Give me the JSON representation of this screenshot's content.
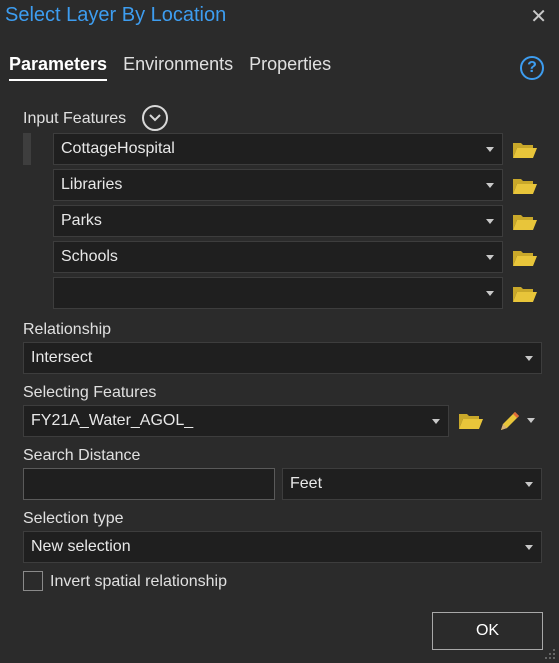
{
  "window": {
    "title": "Select Layer By Location",
    "close_glyph": "✕"
  },
  "tabs": [
    {
      "label": "Parameters",
      "active": true
    },
    {
      "label": "Environments",
      "active": false
    },
    {
      "label": "Properties",
      "active": false
    }
  ],
  "help_glyph": "?",
  "input_features": {
    "label": "Input Features",
    "items": [
      "CottageHospital",
      "Libraries",
      "Parks",
      "Schools",
      ""
    ]
  },
  "relationship": {
    "label": "Relationship",
    "value": "Intersect"
  },
  "selecting_features": {
    "label": "Selecting Features",
    "value": "FY21A_Water_AGOL_"
  },
  "search_distance": {
    "label": "Search Distance",
    "value": "",
    "unit": "Feet"
  },
  "selection_type": {
    "label": "Selection type",
    "value": "New selection"
  },
  "invert": {
    "label": "Invert spatial relationship",
    "checked": false
  },
  "ok_button": {
    "label": "OK"
  },
  "colors": {
    "accent": "#3d9df0",
    "folder": "#e8c53a",
    "background": "#2b2b2b",
    "field": "#1f1f1f"
  },
  "icons": [
    "close-icon",
    "help-icon",
    "chevron-down-icon",
    "folder-icon",
    "pencil-icon",
    "resize-grip-icon"
  ]
}
